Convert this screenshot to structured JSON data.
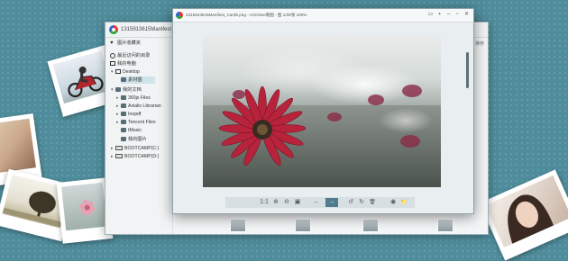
{
  "explorer": {
    "title": "1315913615Manifest_C",
    "sort_label": "排序",
    "nav": {
      "favorites": "图片收藏夹",
      "recent": "最近访问的目录",
      "computer": "我的电脑",
      "desktop": "Desktop",
      "wallpaper": "素材图",
      "documents": "我的文档",
      "docs_items": [
        "360js Files",
        "Axialis Librarian",
        "Inopdf",
        "Tencent Files",
        "tMusic"
      ],
      "pictures": "我的图片",
      "drives": [
        "BOOTCAMP(C:)",
        "BOOTCAMP(D:)"
      ]
    }
  },
  "viewer": {
    "title": "1315913615Manifest_Card5.png - ACDSee看图 - 图 1/28张 100%",
    "window_buttons": [
      "▭",
      "▪",
      "–",
      "▫",
      "✕"
    ],
    "toolbar": {
      "actual_size": "1:1",
      "zoom_in": "⊕",
      "zoom_out": "⊖",
      "fit": "▣",
      "prev": "←",
      "next": "→",
      "rotate_left": "↺",
      "rotate_right": "↻",
      "delete": "🗑",
      "fullscreen": "◉",
      "folder": "📁"
    }
  },
  "colors": {
    "desktop_bg": "#4f8d9c",
    "toolbar_active": "#4f7c8d",
    "flower": "#b7233b"
  }
}
